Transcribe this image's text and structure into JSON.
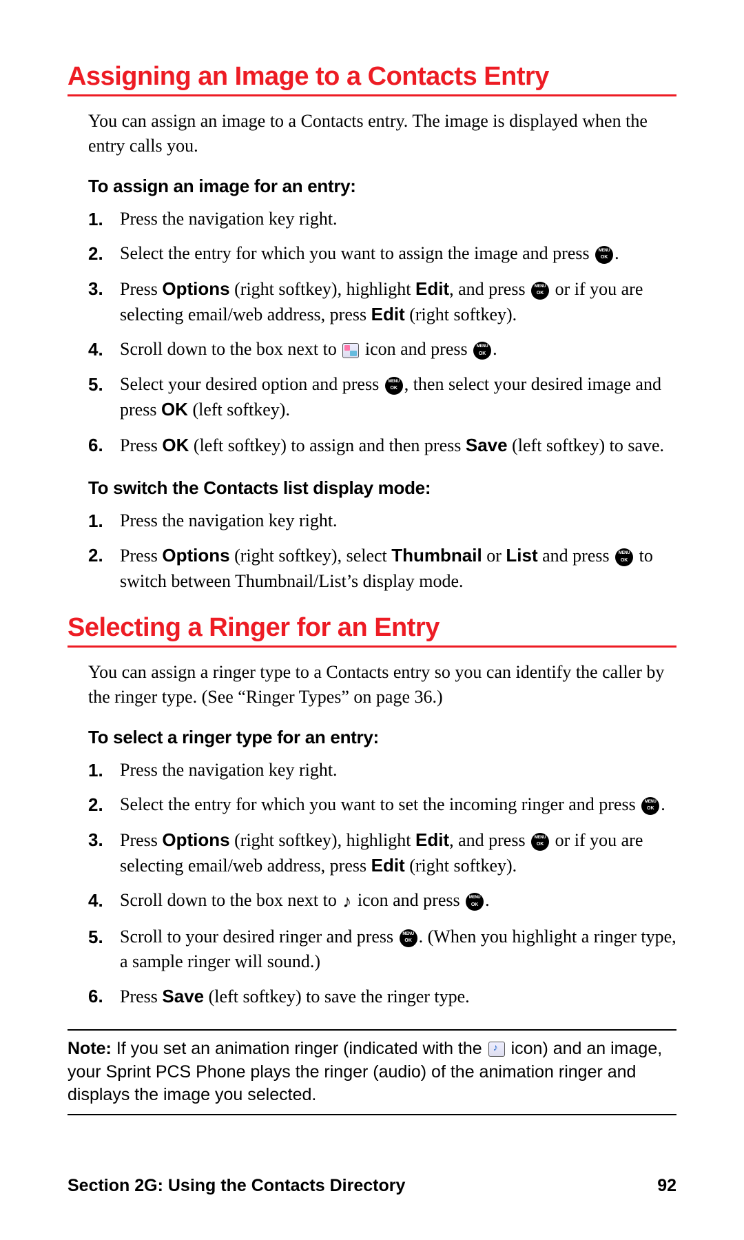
{
  "colors": {
    "accent": "#ed1c24"
  },
  "section1": {
    "heading": "Assigning an Image to a Contacts Entry",
    "intro": "You can assign an image to a Contacts entry. The image is displayed when the entry calls you.",
    "sub1": "To assign an image for an entry:",
    "steps1": {
      "s1": "Press the navigation key right.",
      "s2a": "Select the entry for which you want to assign the image and press ",
      "s2b": ".",
      "s3a": "Press ",
      "s3b": "Options",
      "s3c": " (right softkey), highlight ",
      "s3d": "Edit",
      "s3e": ", and press ",
      "s3f": " or if you are selecting email/web address, press ",
      "s3g": "Edit",
      "s3h": " (right softkey).",
      "s4a": "Scroll down to the box next to ",
      "s4b": " icon and press ",
      "s4c": ".",
      "s5a": "Select your desired option and press ",
      "s5b": ", then select your desired image and press ",
      "s5c": "OK",
      "s5d": " (left softkey).",
      "s6a": "Press ",
      "s6b": "OK",
      "s6c": " (left softkey) to assign and then press ",
      "s6d": "Save",
      "s6e": " (left softkey) to save."
    },
    "sub2": "To switch the Contacts list display mode:",
    "steps2": {
      "s1": "Press the navigation key right.",
      "s2a": "Press ",
      "s2b": "Options",
      "s2c": " (right softkey), select ",
      "s2d": "Thumbnail",
      "s2e": " or ",
      "s2f": "List",
      "s2g": " and press ",
      "s2h": " to switch between Thumbnail/List’s display mode."
    }
  },
  "section2": {
    "heading": "Selecting a Ringer for an Entry",
    "intro": "You can assign a ringer type to a Contacts entry so you can identify the caller by the ringer type. (See “Ringer Types” on page 36.)",
    "sub1": "To select a ringer type for an entry:",
    "steps": {
      "s1": "Press the navigation key right.",
      "s2a": "Select the entry for which you want to set the incoming ringer and press ",
      "s2b": ".",
      "s3a": "Press ",
      "s3b": "Options",
      "s3c": " (right softkey), highlight ",
      "s3d": "Edit",
      "s3e": ", and press ",
      "s3f": " or if you are selecting email/web address, press ",
      "s3g": "Edit",
      "s3h": " (right softkey).",
      "s4a": "Scroll down to the box next to ",
      "s4b": " icon and press ",
      "s4c": ".",
      "s5a": "Scroll to your desired ringer and press ",
      "s5b": ". (When you highlight a ringer type, a sample ringer will sound.)",
      "s6a": "Press ",
      "s6b": "Save",
      "s6c": " (left softkey) to save the ringer type."
    }
  },
  "note": {
    "label": "Note:",
    "t1": " If you set an animation ringer (indicated with the ",
    "t2": " icon) and an image, your Sprint PCS Phone plays the ringer (audio) of the animation ringer and displays the image you selected."
  },
  "footer": {
    "left": "Section 2G: Using the Contacts Directory",
    "right": "92"
  },
  "nums": {
    "n1": "1.",
    "n2": "2.",
    "n3": "3.",
    "n4": "4.",
    "n5": "5.",
    "n6": "6."
  }
}
